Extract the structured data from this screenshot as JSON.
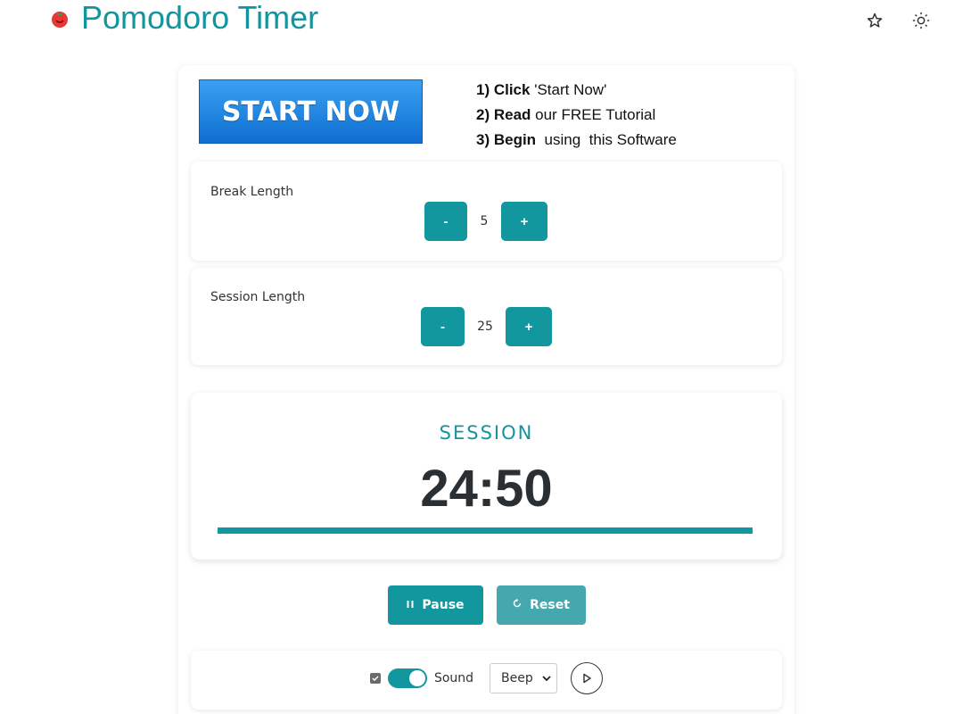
{
  "app": {
    "title": "Pomodoro Timer",
    "brand_color": "#13959f"
  },
  "header_icons": [
    {
      "name": "star-icon"
    },
    {
      "name": "sun-icon"
    }
  ],
  "ad": {
    "button_label": "START NOW",
    "steps": [
      {
        "bold": "1) Click",
        "text": " 'Start Now'"
      },
      {
        "bold": "2) Read",
        "text": " our FREE Tutorial"
      },
      {
        "bold": "3) Begin",
        "text": "  using  this Software"
      }
    ]
  },
  "break": {
    "label": "Break Length",
    "minus": "-",
    "value": "5",
    "plus": "+"
  },
  "session": {
    "label": "Session Length",
    "minus": "-",
    "value": "25",
    "plus": "+"
  },
  "timer": {
    "mode": "SESSION",
    "time": "24:50",
    "progress_percent": 100
  },
  "controls": {
    "pause_label": "Pause",
    "reset_label": "Reset"
  },
  "sound": {
    "checkbox_checked": true,
    "toggle_on": true,
    "label": "Sound",
    "selected": "Beep"
  }
}
